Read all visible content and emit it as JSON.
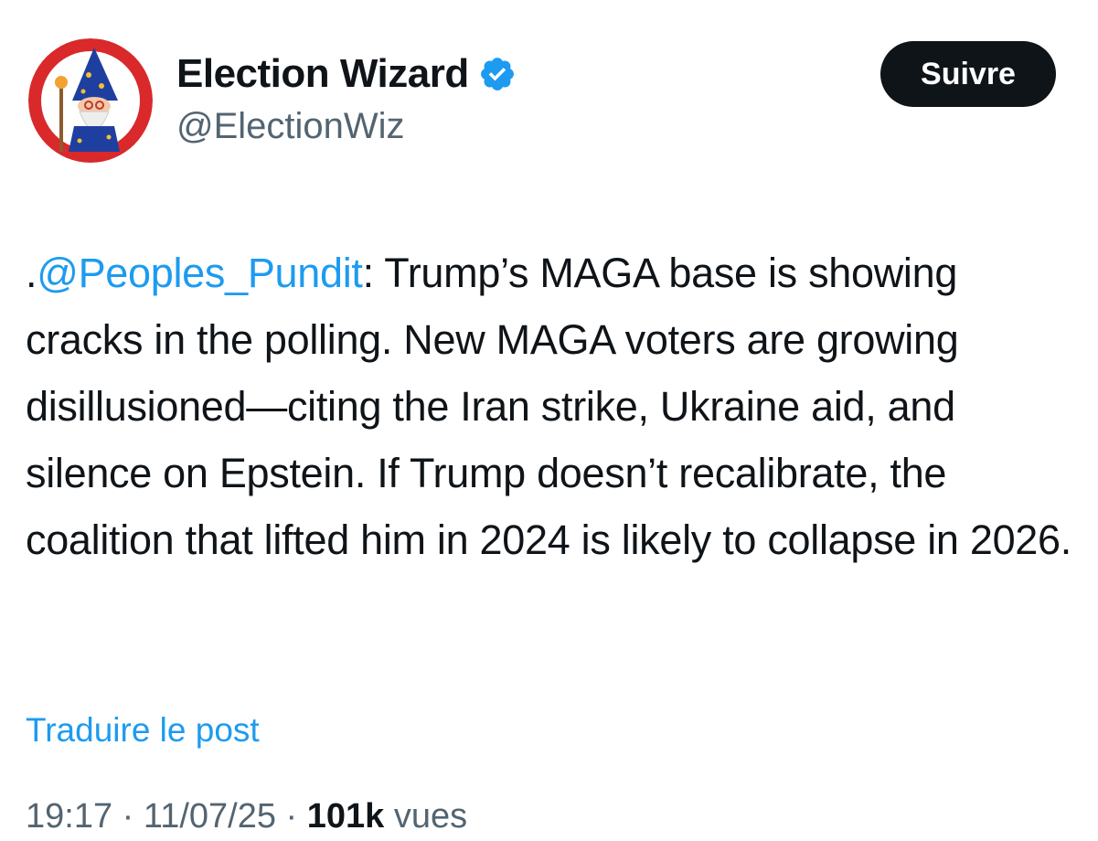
{
  "author": {
    "display_name": "Election Wizard",
    "handle": "@ElectionWiz",
    "verified": true,
    "avatar_icon": "wizard-avatar-icon",
    "avatar_bg_color": "#d9292b",
    "verified_color": "#1d9bf0"
  },
  "follow_button": {
    "label": "Suivre"
  },
  "tweet": {
    "prefix": ".",
    "mention": "@Peoples_Pundit",
    "body": ": Trump’s MAGA base is showing cracks in the polling. New MAGA voters are growing disillusioned—citing the Iran strike, Ukraine aid, and silence on Epstein. If Trump doesn’t recalibrate, the coalition that lifted him in 2024 is likely to collapse in 2026."
  },
  "translate_link": "Traduire le post",
  "meta": {
    "time": "19:17",
    "separator": " · ",
    "date": "11/07/25",
    "views_count": "101k",
    "views_label": " vues"
  },
  "colors": {
    "text": "#0f1419",
    "secondary": "#536471",
    "link": "#1d9bf0",
    "button_bg": "#0f1419",
    "button_text": "#ffffff"
  }
}
